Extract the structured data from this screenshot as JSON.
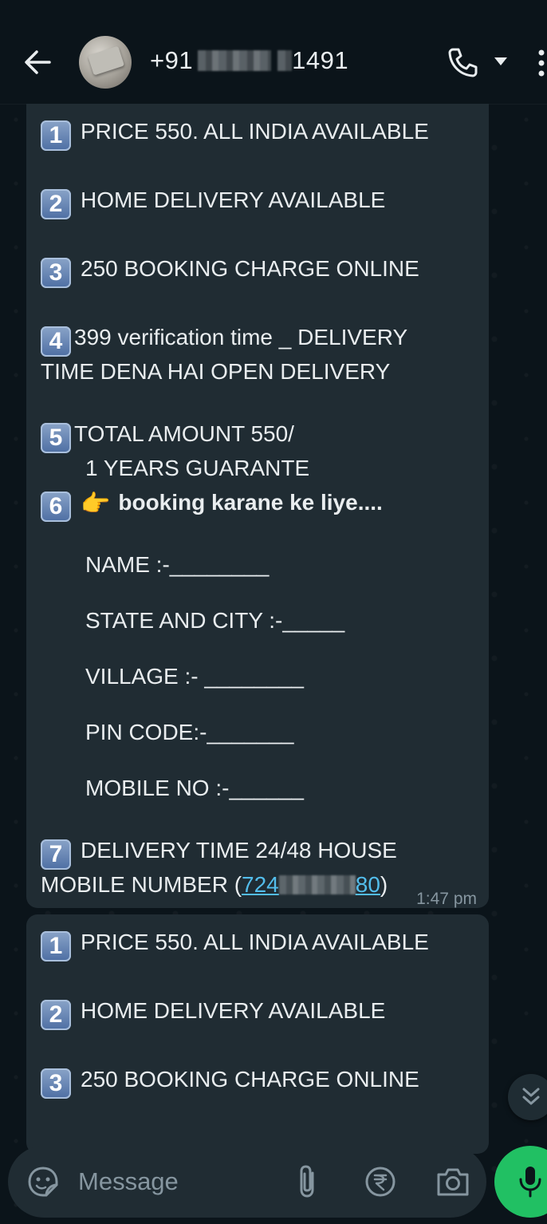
{
  "header": {
    "contact_prefix": "+91",
    "contact_suffix": "1491",
    "icons": [
      "back-arrow-icon",
      "avatar",
      "phone-icon",
      "caret-down-icon",
      "more-vert-icon"
    ]
  },
  "message1": {
    "l1": "PRICE 550. ALL INDIA AVAILABLE",
    "l2": "HOME DELIVERY  AVAILABLE",
    "l3": "250 BOOKING CHARGE ONLINE",
    "l4a": "399 verification time _  DELIVERY",
    "l4b": "TIME DENA HAI OPEN DELIVERY",
    "l5a": "TOTAL AMOUNT 550/",
    "l5b": "1 YEARS GUARANTE",
    "l6": "booking karane ke liye....",
    "f1": "NAME :-________",
    "f2": "STATE AND CITY  :-_____",
    "f3": "VILLAGE :- ________",
    "f4": "PIN CODE:-_______",
    "f5": "MOBILE NO :-______",
    "l7a": "DELIVERY TIME 24/48 HOUSE",
    "l7b_prefix": "MOBILE NUMBER (",
    "l7b_link_start": "724",
    "l7b_link_end": "80",
    "l7b_suffix": ")",
    "time": "1:47 pm"
  },
  "message2": {
    "l1": "PRICE 550. ALL INDIA AVAILABLE",
    "l2": "HOME DELIVERY  AVAILABLE",
    "l3": "250 BOOKING CHARGE ONLINE"
  },
  "badges": [
    "1",
    "2",
    "3",
    "4",
    "5",
    "6",
    "7"
  ],
  "composer": {
    "placeholder": "Message"
  },
  "colors": {
    "background": "#0b141a",
    "bubble": "#202c33",
    "link": "#53bdeb",
    "mic_button": "#21c063"
  }
}
